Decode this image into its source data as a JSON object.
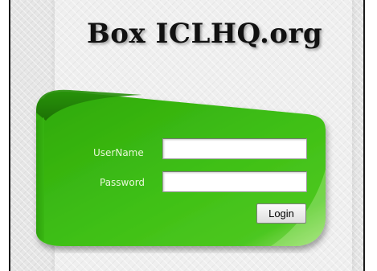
{
  "page": {
    "title": "Box ICLHQ.org"
  },
  "login_form": {
    "username_label": "UserName",
    "username_value": "",
    "password_label": "Password",
    "password_value": "",
    "login_label": "Login"
  },
  "colors": {
    "banner_green": "#3dbb13",
    "banner_dark_green": "#1f7a06",
    "background": "#ebebeb"
  }
}
